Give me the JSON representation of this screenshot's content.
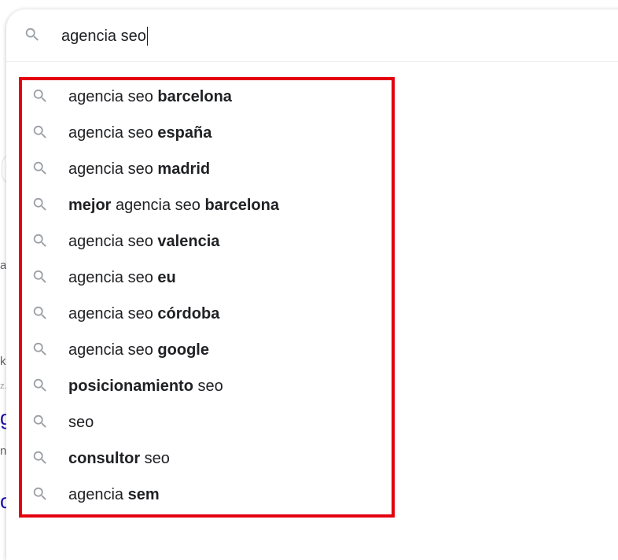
{
  "search": {
    "query": "agencia seo"
  },
  "suggestions": [
    {
      "parts": [
        {
          "text": "agencia seo ",
          "bold": false
        },
        {
          "text": "barcelona",
          "bold": true
        }
      ]
    },
    {
      "parts": [
        {
          "text": "agencia seo ",
          "bold": false
        },
        {
          "text": "españa",
          "bold": true
        }
      ]
    },
    {
      "parts": [
        {
          "text": "agencia seo ",
          "bold": false
        },
        {
          "text": "madrid",
          "bold": true
        }
      ]
    },
    {
      "parts": [
        {
          "text": "mejor",
          "bold": true
        },
        {
          "text": " agencia seo ",
          "bold": false
        },
        {
          "text": "barcelona",
          "bold": true
        }
      ]
    },
    {
      "parts": [
        {
          "text": "agencia seo ",
          "bold": false
        },
        {
          "text": "valencia",
          "bold": true
        }
      ]
    },
    {
      "parts": [
        {
          "text": "agencia seo ",
          "bold": false
        },
        {
          "text": "eu",
          "bold": true
        }
      ]
    },
    {
      "parts": [
        {
          "text": "agencia seo ",
          "bold": false
        },
        {
          "text": "córdoba",
          "bold": true
        }
      ]
    },
    {
      "parts": [
        {
          "text": "agencia seo ",
          "bold": false
        },
        {
          "text": "google",
          "bold": true
        }
      ]
    },
    {
      "parts": [
        {
          "text": "posicionamiento",
          "bold": true
        },
        {
          "text": " seo",
          "bold": false
        }
      ]
    },
    {
      "parts": [
        {
          "text": "seo",
          "bold": false
        }
      ]
    },
    {
      "parts": [
        {
          "text": "consultor",
          "bold": true
        },
        {
          "text": " seo",
          "bold": false
        }
      ]
    },
    {
      "parts": [
        {
          "text": "agencia ",
          "bold": false
        },
        {
          "text": "sem",
          "bold": true
        }
      ]
    }
  ],
  "background_fragments": {
    "frag_a": "a",
    "frag_k": "k",
    "frag_z": "z.",
    "frag_g": "g",
    "frag_n": "n",
    "frag_o": "o"
  },
  "colors": {
    "highlight_border": "#e3000f",
    "icon": "#9aa0a6",
    "text": "#202124",
    "link": "#1a0dab"
  },
  "icons": {
    "search": "search-icon"
  }
}
